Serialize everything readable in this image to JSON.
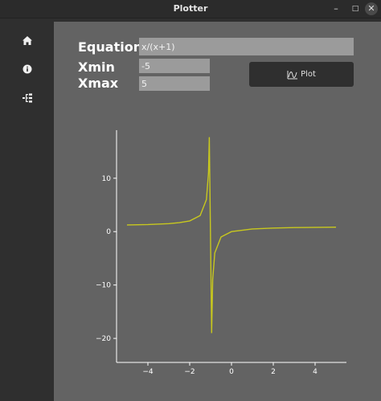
{
  "window": {
    "title": "Plotter"
  },
  "window_controls": {
    "minimize": "–",
    "maximize": "□",
    "close": "✕"
  },
  "sidebar": {
    "items": [
      {
        "icon": "home-icon"
      },
      {
        "icon": "info-icon"
      },
      {
        "icon": "tree-icon"
      }
    ]
  },
  "form": {
    "equation_label": "Equation",
    "equation_value": "x/(x+1)",
    "xmin_label": "Xmin",
    "xmin_value": "-5",
    "xmax_label": "Xmax",
    "xmax_value": "5",
    "plot_button_label": "Plot"
  },
  "colors": {
    "curve": "#c8c81e",
    "background": "#636363",
    "sidebar": "#2f2f2f"
  },
  "chart_data": {
    "type": "line",
    "function": "x/(x+1)",
    "xlim": [
      -5.5,
      5.5
    ],
    "ylim": [
      -24.5,
      19
    ],
    "xticks": [
      -4,
      -2,
      0,
      2,
      4
    ],
    "yticks": [
      -20,
      -10,
      0,
      10
    ],
    "xtick_labels": [
      "−4",
      "−2",
      "0",
      "2",
      "4"
    ],
    "ytick_labels": [
      "−20",
      "−10",
      "0",
      "10"
    ],
    "x": [
      -5,
      -4,
      -3,
      -2.5,
      -2,
      -1.5,
      -1.2,
      -1.1,
      -1.06,
      -0.95,
      -0.9,
      -0.8,
      -0.5,
      0,
      1,
      2,
      3,
      4,
      5
    ],
    "y": [
      1.25,
      1.33,
      1.5,
      1.67,
      2,
      3,
      6,
      11,
      17.7,
      -19,
      -9,
      -4,
      -1,
      0,
      0.5,
      0.67,
      0.75,
      0.8,
      0.83
    ],
    "grid": false
  }
}
